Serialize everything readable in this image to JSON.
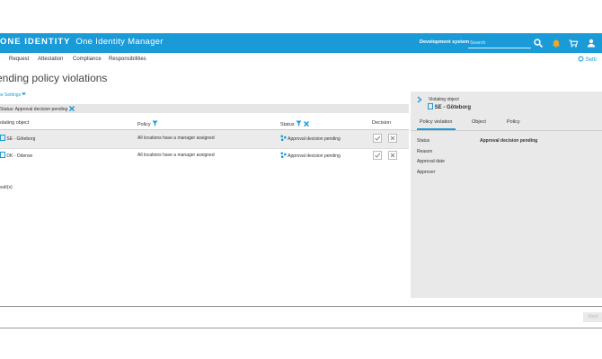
{
  "header": {
    "brand_prefix": "ONE IDENTITY",
    "brand_name": "One Identity Manager",
    "environment": "Development system",
    "search_placeholder": "Search"
  },
  "menu": {
    "items": [
      "Request",
      "Attestation",
      "Compliance",
      "Responsibilities"
    ],
    "settings": "Setti"
  },
  "page": {
    "title": "ending policy violations",
    "view_settings": "w Settings",
    "filter": "Status: Approval decision pending"
  },
  "table": {
    "columns": [
      "olating object",
      "Policy",
      "Status",
      "Decision"
    ],
    "rows": [
      {
        "object": "SE - Göteborg",
        "policy": "All locations have a manager assigned",
        "status": "Approval decision pending"
      },
      {
        "object": "DK - Odense",
        "policy": "All locations have a manager assigned",
        "status": "Approval decision pending"
      }
    ],
    "result": "sult(s)"
  },
  "detail": {
    "heading": "Violating object",
    "object_name": "SE - Göteborg",
    "tabs": [
      "Policy violation",
      "Object",
      "Policy"
    ],
    "fields": [
      {
        "label": "Status",
        "value": "Approval decision pending"
      },
      {
        "label": "Reason",
        "value": ""
      },
      {
        "label": "Approval date",
        "value": ""
      },
      {
        "label": "Approver",
        "value": ""
      }
    ]
  },
  "footer": {
    "next": "Next"
  },
  "colors": {
    "accent": "#1a9bd7",
    "panel": "#e9e9e9",
    "selected_row": "#ebebeb"
  }
}
